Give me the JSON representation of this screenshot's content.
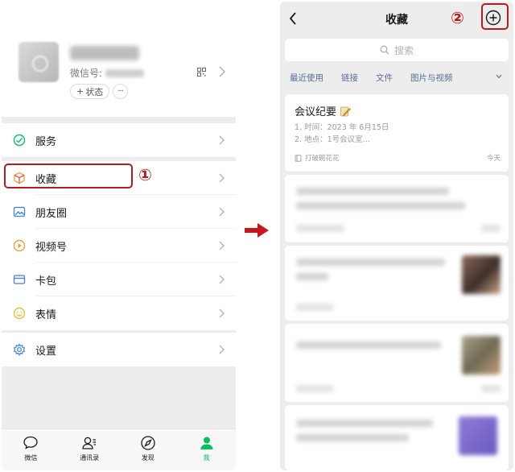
{
  "left": {
    "profile": {
      "wechat_id_label": "微信号:",
      "status_label": "状态",
      "more_label": "···"
    },
    "menu": [
      {
        "name": "service",
        "label": "服务"
      },
      {
        "name": "favorites",
        "label": "收藏"
      },
      {
        "name": "moments",
        "label": "朋友圈"
      },
      {
        "name": "channels",
        "label": "视频号"
      },
      {
        "name": "cards",
        "label": "卡包"
      },
      {
        "name": "stickers",
        "label": "表情"
      },
      {
        "name": "settings",
        "label": "设置"
      }
    ],
    "tabs": [
      {
        "label": "微信",
        "icon": "chat-bubble-icon"
      },
      {
        "label": "通讯录",
        "icon": "contacts-icon"
      },
      {
        "label": "发现",
        "icon": "compass-icon"
      },
      {
        "label": "我",
        "icon": "person-icon"
      }
    ],
    "step_marker": "①"
  },
  "right": {
    "title": "收藏",
    "step_marker": "②",
    "search_placeholder": "搜索",
    "filters": [
      "最近使用",
      "链接",
      "文件",
      "图片与视频"
    ],
    "first_item": {
      "title": "会议纪要",
      "line1": "1. 时间：2023 年 6月15日",
      "line2": "2. 地点：1号会议室…",
      "source": "打破碗花花",
      "time": "今天"
    }
  },
  "colors": {
    "accent_green": "#07c160",
    "annotation_red": "#b71c1c",
    "link_blue": "#576b95",
    "background": "#ededed"
  }
}
